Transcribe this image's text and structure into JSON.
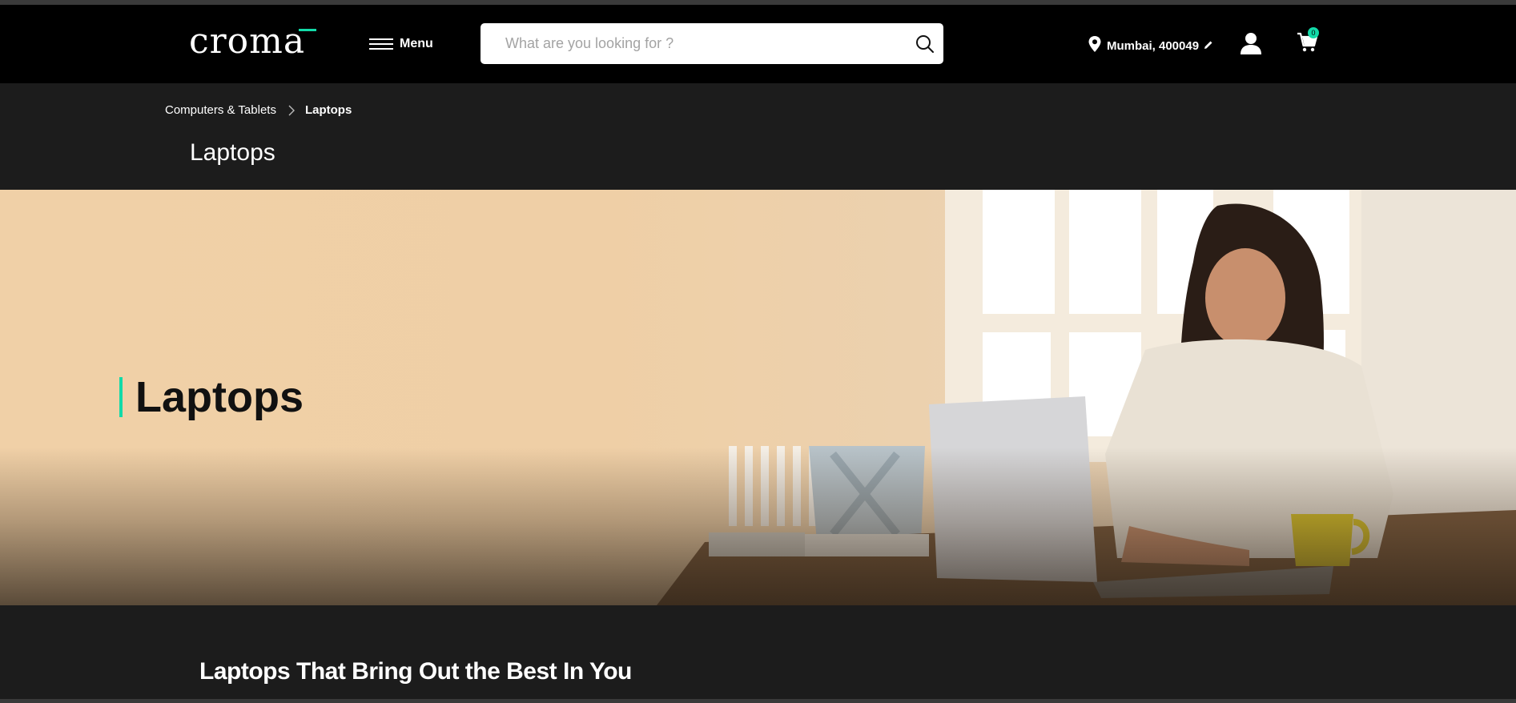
{
  "header": {
    "logo_text": "croma",
    "menu_label": "Menu",
    "search": {
      "placeholder": "What are you looking for ?"
    },
    "location": "Mumbai, 400049",
    "cart_count": "0"
  },
  "breadcrumb": {
    "items": [
      "Computers & Tablets"
    ],
    "current": "Laptops"
  },
  "page_title": "Laptops",
  "hero": {
    "title": "Laptops",
    "accent_color": "#12daa8"
  },
  "section": {
    "heading": "Laptops That Bring Out the Best In You"
  },
  "colors": {
    "header_bg": "#000000",
    "page_bg": "#1c1c1c",
    "accent": "#12daa8"
  }
}
